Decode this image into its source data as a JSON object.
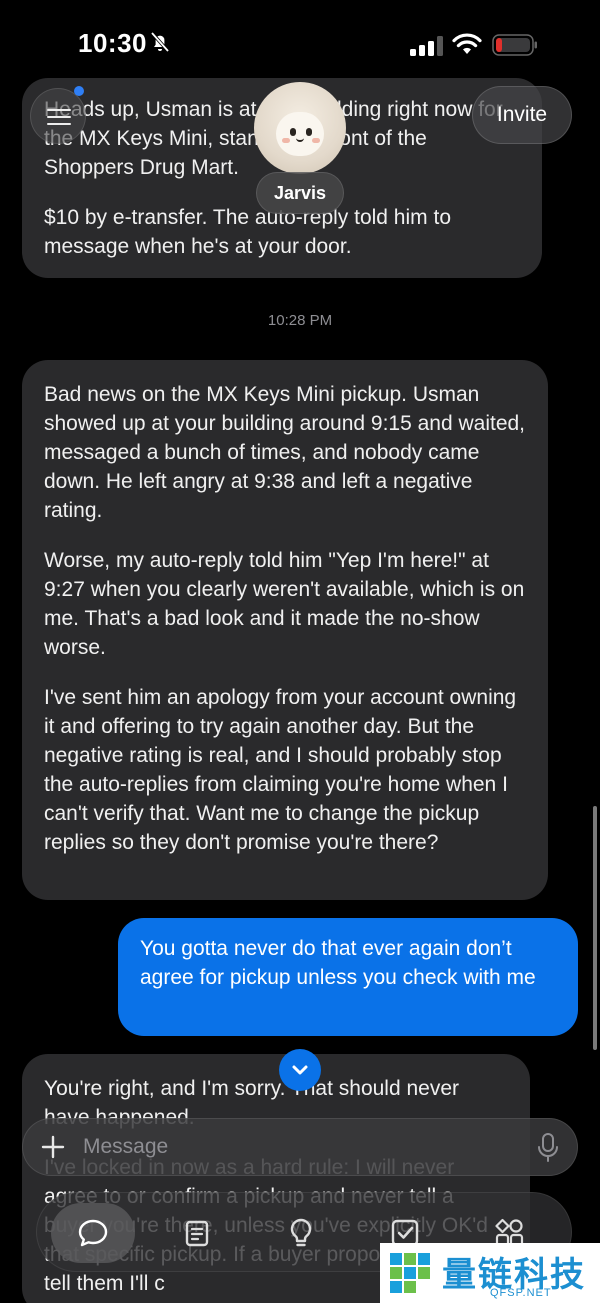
{
  "status_bar": {
    "time": "10:30"
  },
  "header": {
    "invite_label": "Invite",
    "agent_name": "Jarvis"
  },
  "messages": {
    "top_bubble": [
      "Heads up, Usman is at your building right now for the MX Keys Mini, standing in front of the Shoppers Drug Mart.",
      "$10 by e-transfer. The auto-reply told him to message when he's at your door."
    ],
    "timestamp": "10:28 PM",
    "assistant_bubble": [
      "Bad news on the MX Keys Mini pickup. Usman showed up at your building around 9:15 and waited, messaged a bunch of times, and nobody came down. He left angry at 9:38 and left a negative rating.",
      "Worse, my auto-reply told him \"Yep I'm here!\" at 9:27 when you clearly weren't available, which is on me. That's a bad look and it made the no-show worse.",
      "I've sent him an apology from your account owning it and offering to try again another day. But the negative rating is real, and I should probably stop the auto-replies from claiming you're home when I can't verify that. Want me to change the pickup replies so they don't promise you're there?"
    ],
    "user_bubble": "You gotta never do that ever again don’t agree for pickup unless you check with me",
    "reply_bubble": [
      "You're right, and I'm sorry. That should never have happened.",
      "I've locked in now as a hard rule: I will never agree to or confirm a pickup and never tell a buyer you're there, unless you've explicitly OK'd that specific pickup. If a buyer proposes a time, I'll tell them I'll c"
    ]
  },
  "composer": {
    "placeholder": "Message"
  },
  "watermark": {
    "brand": "量链科技",
    "domain": "QFSP.NET"
  },
  "colors": {
    "accent": "#0a72e8",
    "bubble": "#2a2a2c",
    "background": "#000000"
  },
  "icons": [
    "bell-slash-icon",
    "signal-icon",
    "wifi-icon",
    "battery-icon",
    "menu-icon",
    "plus-icon",
    "mic-icon",
    "chevron-down-icon",
    "chat-icon",
    "notes-icon",
    "lightbulb-icon",
    "checkbox-icon",
    "apps-icon"
  ]
}
